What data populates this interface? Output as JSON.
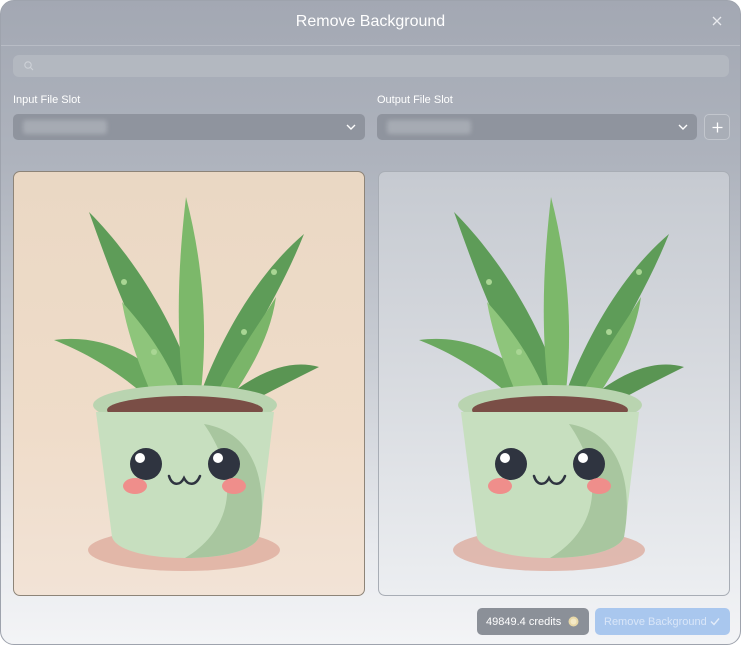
{
  "dialog": {
    "title": "Remove Background"
  },
  "search": {
    "placeholder": ""
  },
  "input_slot": {
    "label": "Input File Slot",
    "value": ""
  },
  "output_slot": {
    "label": "Output File Slot",
    "value": ""
  },
  "footer": {
    "credits_text": "49849.4 credits",
    "remove_button_label": "Remove Background"
  },
  "icons": {
    "close": "close-icon",
    "search": "search-icon",
    "chevron": "chevron-down-icon",
    "add": "plus-icon",
    "coin": "coin-icon",
    "check": "check-icon"
  },
  "colors": {
    "accent_button": "#a9c7ee",
    "input_preview_bg": "#ead8c4"
  }
}
